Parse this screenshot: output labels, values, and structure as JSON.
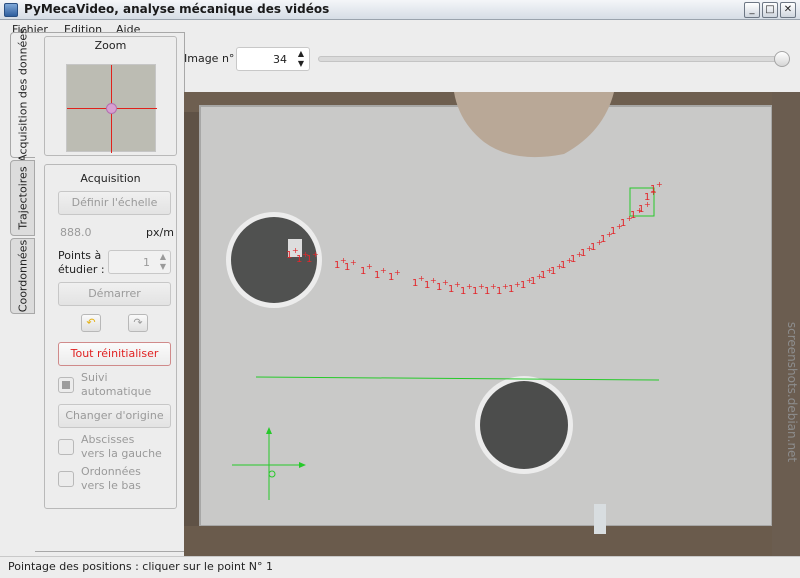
{
  "window": {
    "title": "PyMecaVideo, analyse mécanique des vidéos",
    "buttons": [
      "_",
      "□",
      "✕"
    ]
  },
  "menu": [
    "Fichier",
    "Edition",
    "Aide"
  ],
  "tabs": [
    "Acquisition des données",
    "Trajectoires",
    "Coordonnées"
  ],
  "zoom": {
    "title": "Zoom"
  },
  "acquisition": {
    "title": "Acquisition",
    "define_scale": "Définir l'échelle",
    "scale_value": "888.0",
    "scale_unit": "px/m",
    "points_label_1": "Points à",
    "points_label_2": "étudier :",
    "points_value": "1",
    "start": "Démarrer",
    "undo_icon": "undo-arrow-icon",
    "redo_icon": "redo-arrow-icon",
    "reset": "Tout réinitialiser",
    "auto_follow_1": "Suivi",
    "auto_follow_2": "automatique",
    "change_origin": "Changer d'origine",
    "abscissa_1": "Abscisses",
    "abscissa_2": "vers la gauche",
    "ordinate_1": "Ordonnées",
    "ordinate_2": "vers le bas"
  },
  "image_control": {
    "label": "Image n°",
    "value": "34",
    "slider_fraction": 1.0
  },
  "video": {
    "point_label": "1",
    "watermark": "screenshots.debian.net",
    "colors": {
      "marker": "#e3262a",
      "origin_axis": "#26c92a",
      "table": "#c9c9c8"
    }
  },
  "status": "Pointage des positions : cliquer sur le point N° 1"
}
